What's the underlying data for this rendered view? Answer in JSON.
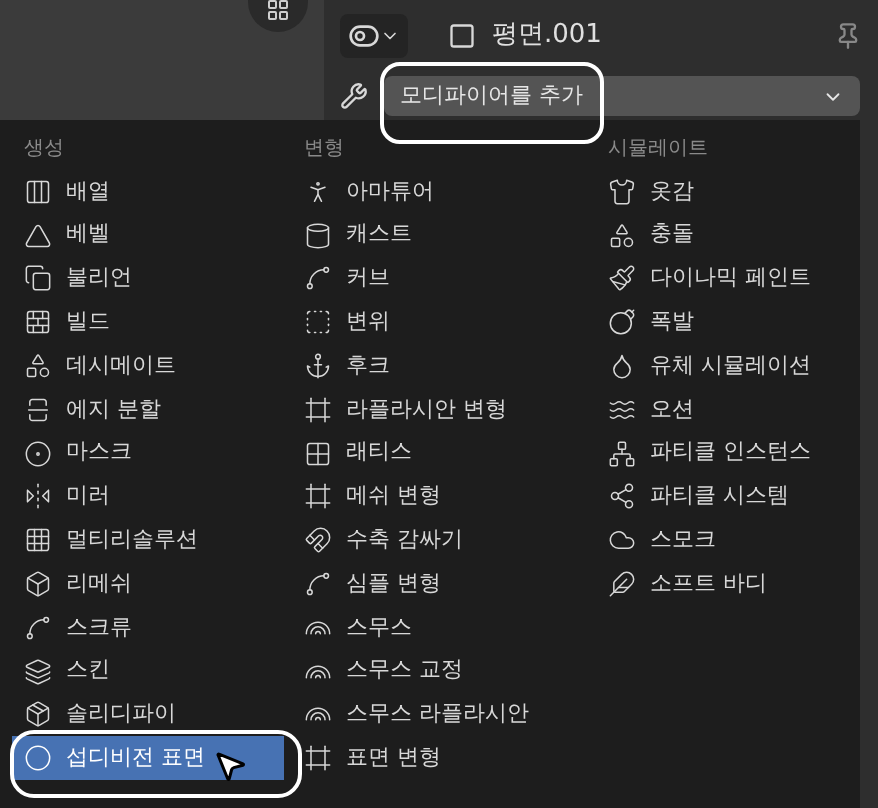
{
  "header": {
    "object_name": "평면.001"
  },
  "add_modifier": {
    "label": "모디파이어를 추가"
  },
  "menu": {
    "columns": [
      {
        "title": "생성",
        "items": [
          {
            "label": "배열",
            "selected": false
          },
          {
            "label": "베벨",
            "selected": false
          },
          {
            "label": "불리언",
            "selected": false
          },
          {
            "label": "빌드",
            "selected": false
          },
          {
            "label": "데시메이트",
            "selected": false
          },
          {
            "label": "에지 분할",
            "selected": false
          },
          {
            "label": "마스크",
            "selected": false
          },
          {
            "label": "미러",
            "selected": false
          },
          {
            "label": "멀티리솔루션",
            "selected": false
          },
          {
            "label": "리메쉬",
            "selected": false
          },
          {
            "label": "스크류",
            "selected": false
          },
          {
            "label": "스킨",
            "selected": false
          },
          {
            "label": "솔리디파이",
            "selected": false
          },
          {
            "label": "섭디비전 표면",
            "selected": true
          }
        ]
      },
      {
        "title": "변형",
        "items": [
          {
            "label": "아마튜어",
            "selected": false
          },
          {
            "label": "캐스트",
            "selected": false
          },
          {
            "label": "커브",
            "selected": false
          },
          {
            "label": "변위",
            "selected": false
          },
          {
            "label": "후크",
            "selected": false
          },
          {
            "label": "라플라시안 변형",
            "selected": false
          },
          {
            "label": "래티스",
            "selected": false
          },
          {
            "label": "메쉬 변형",
            "selected": false
          },
          {
            "label": "수축 감싸기",
            "selected": false
          },
          {
            "label": "심플 변형",
            "selected": false
          },
          {
            "label": "스무스",
            "selected": false
          },
          {
            "label": "스무스 교정",
            "selected": false
          },
          {
            "label": "스무스 라플라시안",
            "selected": false
          },
          {
            "label": "표면 변형",
            "selected": false
          }
        ]
      },
      {
        "title": "시뮬레이트",
        "items": [
          {
            "label": "옷감",
            "selected": false
          },
          {
            "label": "충돌",
            "selected": false
          },
          {
            "label": "다이나믹 페인트",
            "selected": false
          },
          {
            "label": "폭발",
            "selected": false
          },
          {
            "label": "유체 시뮬레이션",
            "selected": false
          },
          {
            "label": "오션",
            "selected": false
          },
          {
            "label": "파티클 인스턴스",
            "selected": false
          },
          {
            "label": "파티클 시스템",
            "selected": false
          },
          {
            "label": "스모크",
            "selected": false
          },
          {
            "label": "소프트 바디",
            "selected": false
          }
        ]
      }
    ]
  }
}
